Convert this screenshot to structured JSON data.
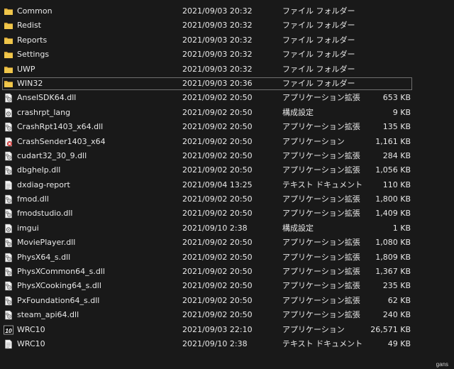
{
  "files": [
    {
      "name": "Common",
      "date": "2021/09/03 20:32",
      "type": "ファイル フォルダー",
      "size": "",
      "icon": "folder-icon"
    },
    {
      "name": "Redist",
      "date": "2021/09/03 20:32",
      "type": "ファイル フォルダー",
      "size": "",
      "icon": "folder-icon"
    },
    {
      "name": "Reports",
      "date": "2021/09/03 20:32",
      "type": "ファイル フォルダー",
      "size": "",
      "icon": "folder-icon"
    },
    {
      "name": "Settings",
      "date": "2021/09/03 20:32",
      "type": "ファイル フォルダー",
      "size": "",
      "icon": "folder-icon"
    },
    {
      "name": "UWP",
      "date": "2021/09/03 20:32",
      "type": "ファイル フォルダー",
      "size": "",
      "icon": "folder-icon"
    },
    {
      "name": "WIN32",
      "date": "2021/09/03 20:36",
      "type": "ファイル フォルダー",
      "size": "",
      "icon": "folder-icon",
      "selected": true
    },
    {
      "name": "AnselSDK64.dll",
      "date": "2021/09/02 20:50",
      "type": "アプリケーション拡張",
      "size": "653 KB",
      "icon": "dll-icon"
    },
    {
      "name": "crashrpt_lang",
      "date": "2021/09/02 20:50",
      "type": "構成設定",
      "size": "9 KB",
      "icon": "config-icon"
    },
    {
      "name": "CrashRpt1403_x64.dll",
      "date": "2021/09/02 20:50",
      "type": "アプリケーション拡張",
      "size": "135 KB",
      "icon": "dll-icon"
    },
    {
      "name": "CrashSender1403_x64",
      "date": "2021/09/02 20:50",
      "type": "アプリケーション",
      "size": "1,161 KB",
      "icon": "crash-app-icon"
    },
    {
      "name": "cudart32_30_9.dll",
      "date": "2021/09/02 20:50",
      "type": "アプリケーション拡張",
      "size": "284 KB",
      "icon": "dll-icon"
    },
    {
      "name": "dbghelp.dll",
      "date": "2021/09/02 20:50",
      "type": "アプリケーション拡張",
      "size": "1,056 KB",
      "icon": "dll-icon"
    },
    {
      "name": "dxdiag-report",
      "date": "2021/09/04 13:25",
      "type": "テキスト ドキュメント",
      "size": "110 KB",
      "icon": "text-file-icon"
    },
    {
      "name": "fmod.dll",
      "date": "2021/09/02 20:50",
      "type": "アプリケーション拡張",
      "size": "1,800 KB",
      "icon": "dll-icon"
    },
    {
      "name": "fmodstudio.dll",
      "date": "2021/09/02 20:50",
      "type": "アプリケーション拡張",
      "size": "1,409 KB",
      "icon": "dll-icon"
    },
    {
      "name": "imgui",
      "date": "2021/09/10 2:38",
      "type": "構成設定",
      "size": "1 KB",
      "icon": "config-icon"
    },
    {
      "name": "MoviePlayer.dll",
      "date": "2021/09/02 20:50",
      "type": "アプリケーション拡張",
      "size": "1,080 KB",
      "icon": "dll-icon"
    },
    {
      "name": "PhysX64_s.dll",
      "date": "2021/09/02 20:50",
      "type": "アプリケーション拡張",
      "size": "1,809 KB",
      "icon": "dll-icon"
    },
    {
      "name": "PhysXCommon64_s.dll",
      "date": "2021/09/02 20:50",
      "type": "アプリケーション拡張",
      "size": "1,367 KB",
      "icon": "dll-icon"
    },
    {
      "name": "PhysXCooking64_s.dll",
      "date": "2021/09/02 20:50",
      "type": "アプリケーション拡張",
      "size": "235 KB",
      "icon": "dll-icon"
    },
    {
      "name": "PxFoundation64_s.dll",
      "date": "2021/09/02 20:50",
      "type": "アプリケーション拡張",
      "size": "62 KB",
      "icon": "dll-icon"
    },
    {
      "name": "steam_api64.dll",
      "date": "2021/09/02 20:50",
      "type": "アプリケーション拡張",
      "size": "240 KB",
      "icon": "dll-icon"
    },
    {
      "name": "WRC10",
      "date": "2021/09/03 22:10",
      "type": "アプリケーション",
      "size": "26,571 KB",
      "icon": "wrc-app-icon"
    },
    {
      "name": "WRC10",
      "date": "2021/09/10 2:38",
      "type": "テキスト ドキュメント",
      "size": "49 KB",
      "icon": "text-file-icon"
    }
  ],
  "watermark": "gans",
  "colors": {
    "background": "#191919",
    "text": "#e8e8e8",
    "folder": "#e8b93e",
    "selection_border": "#6f6f6f"
  }
}
